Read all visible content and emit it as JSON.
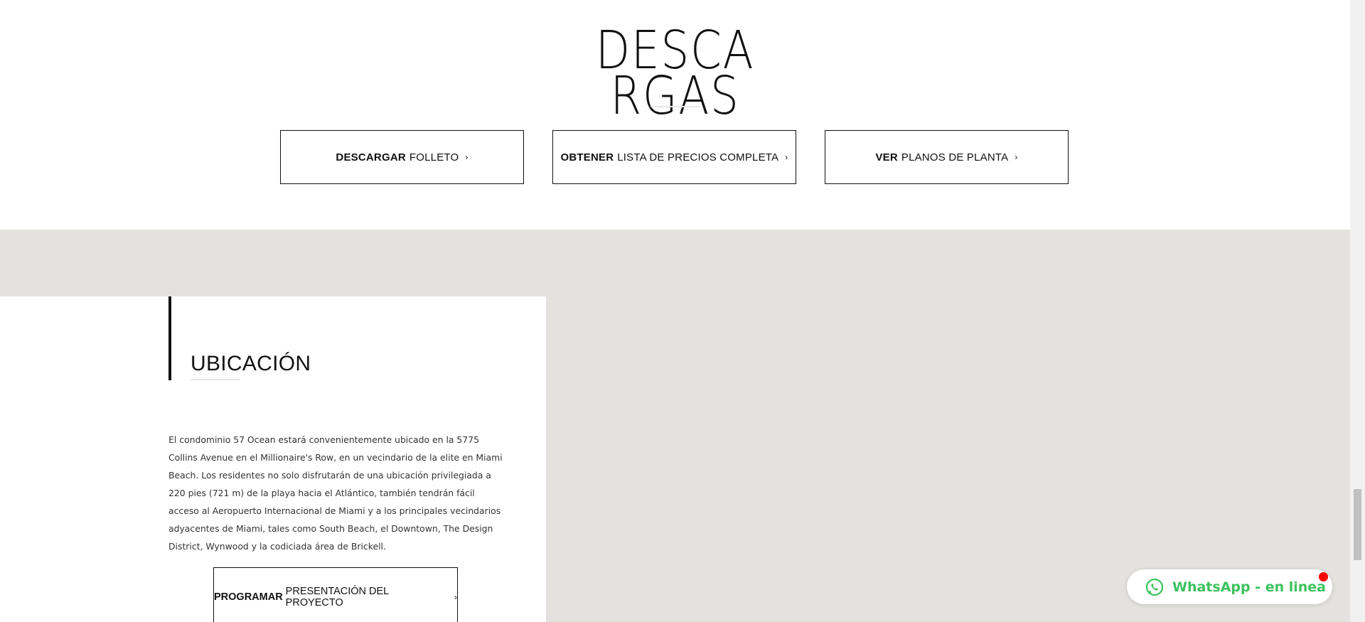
{
  "downloads": {
    "title_line1": "DESCA",
    "title_line2": "RGAS",
    "buttons": [
      {
        "bold": "DESCARGAR",
        "label": "FOLLETO",
        "chevron": "›"
      },
      {
        "bold": "OBTENER",
        "label": "LISTA DE PRECIOS COMPLETA",
        "chevron": "›"
      },
      {
        "bold": "VER",
        "label": "PLANOS DE PLANTA",
        "chevron": "›"
      }
    ]
  },
  "location": {
    "title": "UBICACIÓN",
    "paragraph": "El condominio 57 Ocean estará convenientemente ubicado en la 5775 Collins Avenue en el Millionaire's Row, en un vecindario de la elite en Miami Beach. Los residentes no solo disfrutarán de una ubicación privilegiada a 220 pies (721 m) de la playa hacia el Atlántico, también tendrán fácil acceso al Aeropuerto Internacional de Miami y a los principales vecindarios adyacentes de Miami, tales como South Beach, el Downtown, The Design District, Wynwood y la codiciada área de Brickell.",
    "button": {
      "bold": "PROGRAMAR",
      "label": "PRESENTACIÓN DEL PROYECTO",
      "chevron": "›"
    }
  },
  "whatsapp": {
    "label": "WhatsApp - en linea",
    "icon": "whatsapp-icon",
    "color": "#3cc25d",
    "dot_color": "#ff0000"
  },
  "colors": {
    "section_gray": "#e3e2de",
    "text_dark": "#111111"
  }
}
